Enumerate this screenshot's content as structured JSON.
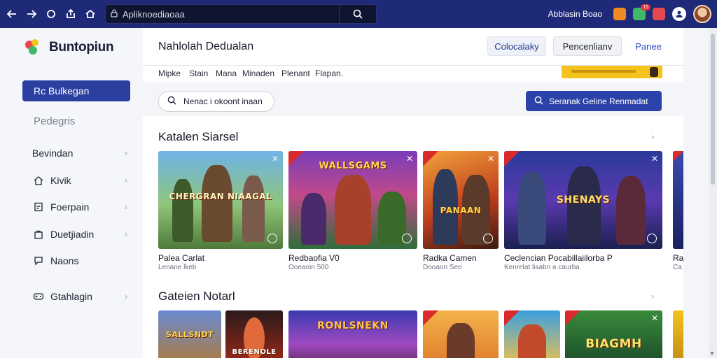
{
  "browser": {
    "url": "Apliknoediaoaa",
    "account_label": "Abblasin Boao",
    "notif_badge": "15",
    "colors": {
      "bar": "#1e2a78",
      "url_bg": "#0f1530"
    }
  },
  "sidebar": {
    "logo_text": "Buntopiun",
    "active_item": "Rc Bulkegan",
    "section_label": "Pedegris",
    "items": [
      {
        "label": "Bevindan",
        "icon": "none"
      },
      {
        "label": "Kivik",
        "icon": "home-icon"
      },
      {
        "label": "Foerpain",
        "icon": "document-icon"
      },
      {
        "label": "Duetjiadin",
        "icon": "bag-icon"
      },
      {
        "label": "Naons",
        "icon": "chat-icon"
      },
      {
        "label": "Gtahlagin",
        "icon": "gamepad-icon"
      }
    ]
  },
  "main": {
    "title": "Nahlolah Dedualan",
    "buttons": {
      "a": "Colocalaky",
      "b": "Pencenlianv",
      "c": "Panee"
    },
    "filters": [
      "Mipke",
      "Stain",
      "Mana",
      "Minaden",
      "Plenant",
      "Flapan."
    ],
    "search_placeholder": "Nenac i okoont inaan",
    "search_button": "Seranak Geline Renmadat",
    "sections": [
      {
        "title": "Katalen Siarsel",
        "cards": [
          {
            "title": "Palea Carlat",
            "sub": "Lenane lkeb",
            "banner": "CHERGRAN NIAAGAL"
          },
          {
            "title": "Redbaofia V0",
            "sub": "Ooeaoin 500",
            "banner": "WALLSGAMS"
          },
          {
            "title": "Radka Camen",
            "sub": "Dooaon Seo",
            "banner": "PANAAN"
          },
          {
            "title": "Ceclencian Pocabillaiilorba P",
            "sub": "Kenrelat lisabn a caurba",
            "banner": "SHENAYS"
          },
          {
            "title": "Ra",
            "sub": "Ca",
            "banner": ""
          }
        ]
      },
      {
        "title": "Gateien Notarl",
        "cards": [
          {
            "banner": "SALLSNDT"
          },
          {
            "banner": "BERENOLE"
          },
          {
            "banner": "RONLSNEKN"
          },
          {
            "banner": ""
          },
          {
            "banner": ""
          },
          {
            "banner": "BIAGMH"
          },
          {
            "banner": ""
          }
        ]
      }
    ]
  }
}
